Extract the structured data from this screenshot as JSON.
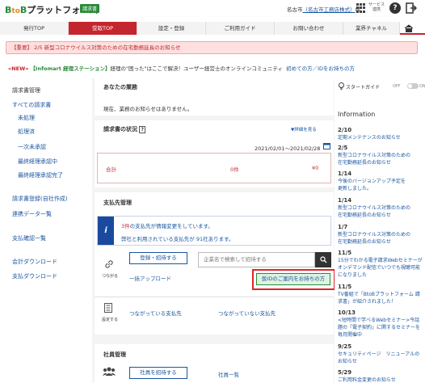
{
  "header": {
    "logo": {
      "b": "B",
      "to": "to",
      "b2": "B",
      "name": "プラットフォーム"
    },
    "badge": "請求書",
    "user_name": "名古市（名古市工務店株式）様",
    "user_name_prefix": "名古市",
    "user_name_link": "（名古市工務店株式）",
    "user_name_suffix": "様",
    "services_label": "サービス 連携"
  },
  "nav": {
    "tabs": [
      "発行TOP",
      "受取TOP",
      "設定・登録",
      "ご利用ガイド",
      "お問い合わせ",
      "業界チャネル"
    ],
    "active_index": 1
  },
  "alert": "【重要】 2/5 新型コロナウイルス対策のための在宅勤務延長のお知らせ",
  "ticker": {
    "new": "«NEW»",
    "source": "【Infomart 経理ステーション】",
    "text": "経理の\"困った\"はここで解決！ユーザー経営士のオンラインコミュニティ",
    "link": "初めての方／IDをお持ちの方"
  },
  "sidebar": {
    "heading": "請求書管理",
    "items": [
      "すべての請求書",
      "未処理",
      "処理済",
      "一次未承認",
      "最終経理承認中",
      "最終経理承認完了"
    ],
    "links": [
      "請求書登録(自社作成)",
      "連携データ一覧",
      "支払確認一覧",
      "会計ダウンロード",
      "支払ダウンロード"
    ]
  },
  "main": {
    "business": {
      "title": "あなたの業務",
      "empty": "現在、業務のお知らせはありません。"
    },
    "invoice_status": {
      "title": "請求書の状況",
      "help": "?",
      "detail_link": "▼詳細を見る",
      "period": "2021/02/01〜2021/02/28",
      "total_label": "合計",
      "count": "0件",
      "amount": "¥0"
    },
    "payees": {
      "title": "支払先管理",
      "notice_count": "3件",
      "notice_rest": "の支払先が情報変更をしています。",
      "notice_line2": "弊社と利用されている支払先が 91社あります。",
      "connect_label": "つながる",
      "register_button": "登録・招待する",
      "search_placeholder": "企業名で検索して招待する",
      "bulk_upload": "一括アップロード",
      "id_guide_button": "仮IDのご案内をお持ちの方",
      "manage_label": "設定する",
      "connected": "つながっている支払先",
      "not_connected": "つながっていない支払先"
    },
    "staff": {
      "title": "社員管理",
      "invite_button": "社員を招待する",
      "list_link": "社員一覧"
    }
  },
  "right": {
    "start_guide": "スタートガイド",
    "toggle_off": "OFF",
    "toggle_on": "ON",
    "info_title": "Information",
    "items": [
      {
        "date": "2/10",
        "text": "定期メンテナンスのお知らせ"
      },
      {
        "date": "2/5",
        "text": "新型コロナウイルス対策のための\n在宅勤務延長のお知らせ"
      },
      {
        "date": "1/14",
        "text": "今後のバージョンアップ予定を\n更新しました。"
      },
      {
        "date": "1/14",
        "text": "新型コロナウイルス対策のための\n在宅勤務延長のお知らせ"
      },
      {
        "date": "1/7",
        "text": "新型コロナウイルス対策のための\n在宅勤務延長のお知らせ"
      },
      {
        "date": "11/5",
        "text": "15分でわかる電子請求Webセミナーがオンデマンド配信でいつでも視聴可能になりました"
      },
      {
        "date": "11/5",
        "text": "TV番組で「BtoBプラットフォーム 請求書」が紹介されました！"
      },
      {
        "date": "10/13",
        "text": "<短時間で学べるWebセミナー>今話題の『電子契約』に関するセミナーを毎月開催中"
      },
      {
        "date": "9/25",
        "text": "セキュリティページ　リニューアルのお知らせ"
      },
      {
        "date": "5/29",
        "text": "ご利用料金変更のお知らせ"
      }
    ]
  }
}
